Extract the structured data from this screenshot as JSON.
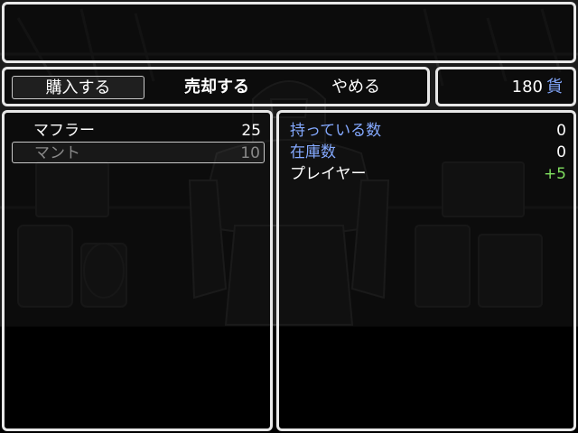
{
  "help": {
    "text": ""
  },
  "commands": {
    "buy": "購入する",
    "sell": "売却する",
    "cancel": "やめる"
  },
  "gold": {
    "value": "180",
    "unit": "貨"
  },
  "items": [
    {
      "name": "マフラー",
      "price": "25",
      "enabled": true
    },
    {
      "name": "マント",
      "price": "10",
      "enabled": false
    }
  ],
  "status": {
    "possession_label": "持っている数",
    "possession_value": "0",
    "stock_label": "在庫数",
    "stock_value": "0",
    "actor_name": "プレイヤー",
    "actor_change": "+5"
  },
  "colors": {
    "window_border": "#e8e8e8",
    "system_text": "#84a9ff",
    "disabled_text": "#8a8a8a",
    "power_up": "#80e060"
  }
}
